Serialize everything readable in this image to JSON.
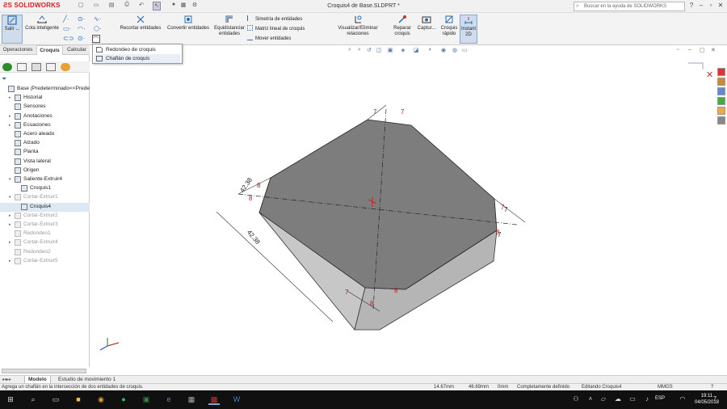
{
  "app": {
    "logo_text": "SOLIDWORKS",
    "title": "Croquis4 de Base.SLDPRT *"
  },
  "help_search": {
    "placeholder": "Buscar en la ayuda de SOLIDWORKS"
  },
  "ribbon": {
    "exit_sketch": "Salir ...",
    "smart_dimension": "Cota inteligente",
    "trim": "Recortar entidades",
    "convert": "Convertir entidades",
    "offset": "Equidistanciar entidades",
    "mirror": "Simetría de entidades",
    "linear_pattern": "Matriz lineal de croquis",
    "move": "Mover entidades",
    "display_relations": "Visualizar/Eliminar relaciones",
    "repair": "Reparar croquis",
    "capture": "Captur...",
    "rapid_sketch": "Croquis rápido",
    "instant2d": "Instant 2D"
  },
  "cm_tabs": [
    "Operaciones",
    "Croquis",
    "Calcular"
  ],
  "cm_active_tab": "Croquis",
  "dropdown": [
    "Redondeo de croquis",
    "Chaflán de croquis"
  ],
  "tree": [
    {
      "label": "Base  (Predeterminado<<Predeterminado>",
      "arrow": "",
      "dim": false,
      "indent": 0
    },
    {
      "label": "Historial",
      "arrow": "▸",
      "dim": false,
      "indent": 1
    },
    {
      "label": "Sensores",
      "arrow": "",
      "dim": false,
      "indent": 1
    },
    {
      "label": "Anotaciones",
      "arrow": "▸",
      "dim": false,
      "indent": 1
    },
    {
      "label": "Ecuaciones",
      "arrow": "▸",
      "dim": false,
      "indent": 1
    },
    {
      "label": "Acero aleado",
      "arrow": "",
      "dim": false,
      "indent": 1
    },
    {
      "label": "Alzado",
      "arrow": "",
      "dim": false,
      "indent": 1
    },
    {
      "label": "Planta",
      "arrow": "",
      "dim": false,
      "indent": 1
    },
    {
      "label": "Vista lateral",
      "arrow": "",
      "dim": false,
      "indent": 1
    },
    {
      "label": "Origen",
      "arrow": "",
      "dim": false,
      "indent": 1
    },
    {
      "label": "Saliente-Extruir4",
      "arrow": "▾",
      "dim": false,
      "indent": 1
    },
    {
      "label": "Croquis1",
      "arrow": "",
      "dim": false,
      "indent": 2
    },
    {
      "label": "Cortar-Extruir1",
      "arrow": "▾",
      "dim": true,
      "indent": 1
    },
    {
      "label": "Croquis4",
      "arrow": "",
      "dim": false,
      "indent": 2,
      "selected": true
    },
    {
      "label": "Cortar-Extruir2",
      "arrow": "▸",
      "dim": true,
      "indent": 1
    },
    {
      "label": "Cortar-Extruir3",
      "arrow": "▸",
      "dim": true,
      "indent": 1
    },
    {
      "label": "Redondeo1",
      "arrow": "",
      "dim": true,
      "indent": 1
    },
    {
      "label": "Cortar-Extruir4",
      "arrow": "▸",
      "dim": true,
      "indent": 1
    },
    {
      "label": "Redondeo2",
      "arrow": "",
      "dim": true,
      "indent": 1
    },
    {
      "label": "Cortar-Extruir5",
      "arrow": "▸",
      "dim": true,
      "indent": 1
    }
  ],
  "dimensions": [
    "7",
    "7",
    "42.38",
    "8",
    "8",
    "7",
    "42.38",
    "8",
    "7",
    "7",
    "7",
    "8",
    "8"
  ],
  "bottom_tabs": [
    "Modelo",
    "Estudio de movimiento 1"
  ],
  "bottom_active": "Modelo",
  "status": {
    "message": "Agrega un chaflán en la intersección de dos entidades de croquis.",
    "x": "14.67mm",
    "y": "46.69mm",
    "z": "0mm",
    "definition": "Completamente definido",
    "editing": "Editando Croquis4",
    "units": "MMGS"
  },
  "taskbar": {
    "lang": "ESP",
    "time": "19:11",
    "date": "04/05/2018",
    "notifications": "7"
  },
  "colors": {
    "model_face": "#7d7d7d",
    "model_side": "#c7c7c7",
    "dimension": "#d01818",
    "accent": "#2b6cb0"
  }
}
